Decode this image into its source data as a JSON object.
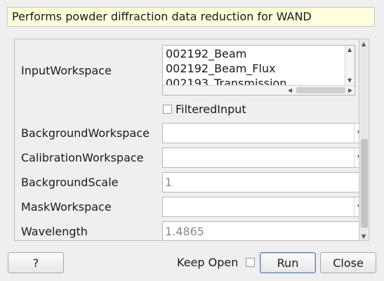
{
  "description": "Performs powder diffraction data reduction for WAND",
  "properties": {
    "input_workspace": {
      "label": "InputWorkspace",
      "items": [
        "002192_Beam",
        "002192_Beam_Flux",
        "002193_Transmission"
      ]
    },
    "filtered_input": {
      "label": "FilteredInput",
      "checked": false
    },
    "background_workspace": {
      "label": "BackgroundWorkspace",
      "value": ""
    },
    "calibration_workspace": {
      "label": "CalibrationWorkspace",
      "value": ""
    },
    "background_scale": {
      "label": "BackgroundScale",
      "value": "1"
    },
    "mask_workspace": {
      "label": "MaskWorkspace",
      "value": ""
    },
    "wavelength": {
      "label": "Wavelength",
      "value": "1.4865"
    }
  },
  "footer": {
    "help_label": "?",
    "keep_open_label": "Keep Open",
    "keep_open_checked": false,
    "run_label": "Run",
    "close_label": "Close"
  },
  "icons": {
    "combo_arrow": "chevron-down-icon",
    "scroll_up": "arrow-up-icon",
    "scroll_down": "arrow-down-icon",
    "scroll_left": "arrow-left-icon",
    "scroll_right": "arrow-right-icon"
  }
}
